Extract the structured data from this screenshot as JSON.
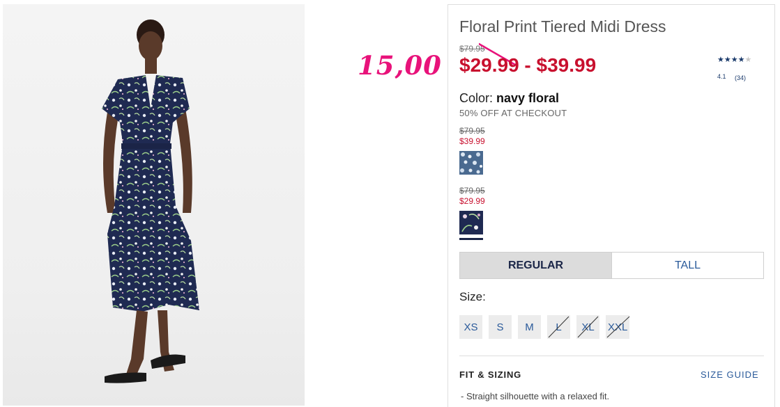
{
  "product": {
    "title": "Floral Print Tiered Midi Dress",
    "original_price": "$79.95",
    "sale_price_range": "$29.99 - $39.99",
    "color_label": "Color: ",
    "color_value": "navy floral",
    "promo": "50% OFF AT CHECKOUT"
  },
  "annotation": {
    "text": "15,00",
    "color": "#e8127a"
  },
  "rating": {
    "stars": 4,
    "max": 5,
    "value": "4.1",
    "count": "(34)"
  },
  "swatches": [
    {
      "original_price": "$79.95",
      "sale_price": "$39.99",
      "name": "blue-floral",
      "selected": false
    },
    {
      "original_price": "$79.95",
      "sale_price": "$29.99",
      "name": "navy-floral",
      "selected": true
    }
  ],
  "fit": {
    "options": [
      "REGULAR",
      "TALL"
    ],
    "selected": "REGULAR"
  },
  "size": {
    "label": "Size:",
    "options": [
      {
        "label": "XS",
        "available": true
      },
      {
        "label": "S",
        "available": true
      },
      {
        "label": "M",
        "available": true
      },
      {
        "label": "L",
        "available": false
      },
      {
        "label": "XL",
        "available": false
      },
      {
        "label": "XXL",
        "available": false
      }
    ]
  },
  "details": {
    "heading": "FIT & SIZING",
    "size_guide": "SIZE GUIDE",
    "bullets": [
      "- Straight silhouette with a relaxed fit."
    ]
  },
  "colors": {
    "sale": "#c8102e",
    "link": "#2a5a9a",
    "navy": "#1a2547"
  }
}
